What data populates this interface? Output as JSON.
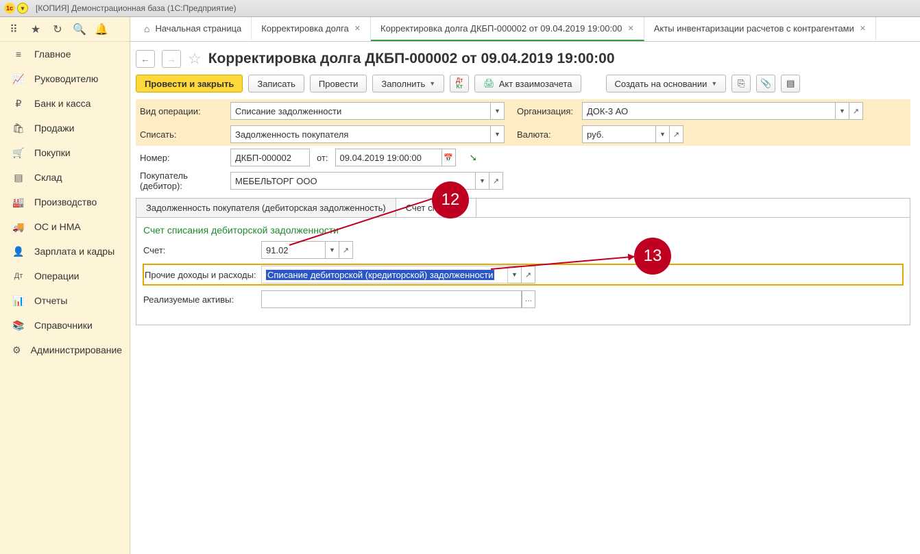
{
  "window_title": "[КОПИЯ] Демонстрационная база  (1С:Предприятие)",
  "sidebar": {
    "items": [
      {
        "icon": "≡",
        "label": "Главное"
      },
      {
        "icon": "📈",
        "label": "Руководителю"
      },
      {
        "icon": "₽",
        "label": "Банк и касса"
      },
      {
        "icon": "🛍",
        "label": "Продажи"
      },
      {
        "icon": "🛒",
        "label": "Покупки"
      },
      {
        "icon": "▤",
        "label": "Склад"
      },
      {
        "icon": "🏭",
        "label": "Производство"
      },
      {
        "icon": "🚚",
        "label": "ОС и НМА"
      },
      {
        "icon": "👤",
        "label": "Зарплата и кадры"
      },
      {
        "icon": "Дт",
        "label": "Операции"
      },
      {
        "icon": "📊",
        "label": "Отчеты"
      },
      {
        "icon": "📚",
        "label": "Справочники"
      },
      {
        "icon": "⚙",
        "label": "Администрирование"
      }
    ]
  },
  "tabs": [
    {
      "label": "Начальная страница",
      "closable": false,
      "home": true
    },
    {
      "label": "Корректировка долга",
      "closable": true
    },
    {
      "label": "Корректировка долга ДКБП-000002 от 09.04.2019 19:00:00",
      "closable": true,
      "active": true
    },
    {
      "label": "Акты инвентаризации расчетов с контрагентами",
      "closable": true
    }
  ],
  "doc_title": "Корректировка долга ДКБП-000002 от 09.04.2019 19:00:00",
  "toolbar": {
    "post_close": "Провести и закрыть",
    "save": "Записать",
    "post": "Провести",
    "fill": "Заполнить",
    "dtkt": "Дт\nКт",
    "act": "Акт взаимозачета",
    "create_based": "Создать на основании"
  },
  "form": {
    "op_type_label": "Вид операции:",
    "op_type_value": "Списание задолженности",
    "write_off_label": "Списать:",
    "write_off_value": "Задолженность покупателя",
    "org_label": "Организация:",
    "org_value": "ДОК-3 АО",
    "currency_label": "Валюта:",
    "currency_value": "руб.",
    "number_label": "Номер:",
    "number_value": "ДКБП-000002",
    "date_from": "от:",
    "date_value": "09.04.2019 19:00:00",
    "buyer_label": "Покупатель (дебитор):",
    "buyer_value": "МЕБЕЛЬТОРГ ООО"
  },
  "doc_tabs": {
    "tab1": "Задолженность покупателя (дебиторская задолженность)",
    "tab2": "Счет списания"
  },
  "section": {
    "title": "Счет списания дебиторской задолженности",
    "account_label": "Счет:",
    "account_value": "91.02",
    "income_label": "Прочие доходы и расходы:",
    "income_value": "Списание дебиторской (кредиторской) задолженности",
    "assets_label": "Реализуемые активы:",
    "assets_value": ""
  },
  "callouts": {
    "c1": "12",
    "c2": "13"
  }
}
